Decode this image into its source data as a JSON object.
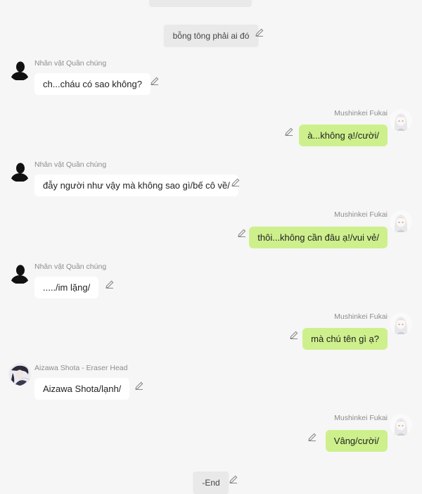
{
  "narration_top": "bỗng tông phải ai đó",
  "narration_end": "-End",
  "messages": [
    {
      "speaker": "Nhân vật Quần chúng",
      "text": "ch...cháu có sao không?"
    },
    {
      "speaker": "Mushinkei Fukai",
      "text": "à...không ạ!/cười/"
    },
    {
      "speaker": "Nhân vật Quần chúng",
      "text": "đẫy người như vậy mà không sao gì/bế cô về/"
    },
    {
      "speaker": "Mushinkei Fukai",
      "text": "thôi...không cần đâu ạ!/vui vẻ/"
    },
    {
      "speaker": "Nhân vật Quần chúng",
      "text": "...../im lặng/"
    },
    {
      "speaker": "Mushinkei Fukai",
      "text": "mà chú tên gì ạ?"
    },
    {
      "speaker": "Aizawa Shota - Eraser Head",
      "text": "Aizawa Shota/lạnh/"
    },
    {
      "speaker": "Mushinkei Fukai",
      "text": "Vâng/cười/"
    }
  ],
  "colors": {
    "background": "#f6f6f6",
    "bubble_left": "#ffffff",
    "bubble_right": "#cdf08c",
    "narration": "#e9e9e9"
  },
  "icons": {
    "edit": "pencil-icon",
    "crowd_avatar": "silhouette-icon",
    "fukai_avatar": "anime-girl-avatar",
    "aizawa_avatar": "anime-man-avatar"
  }
}
